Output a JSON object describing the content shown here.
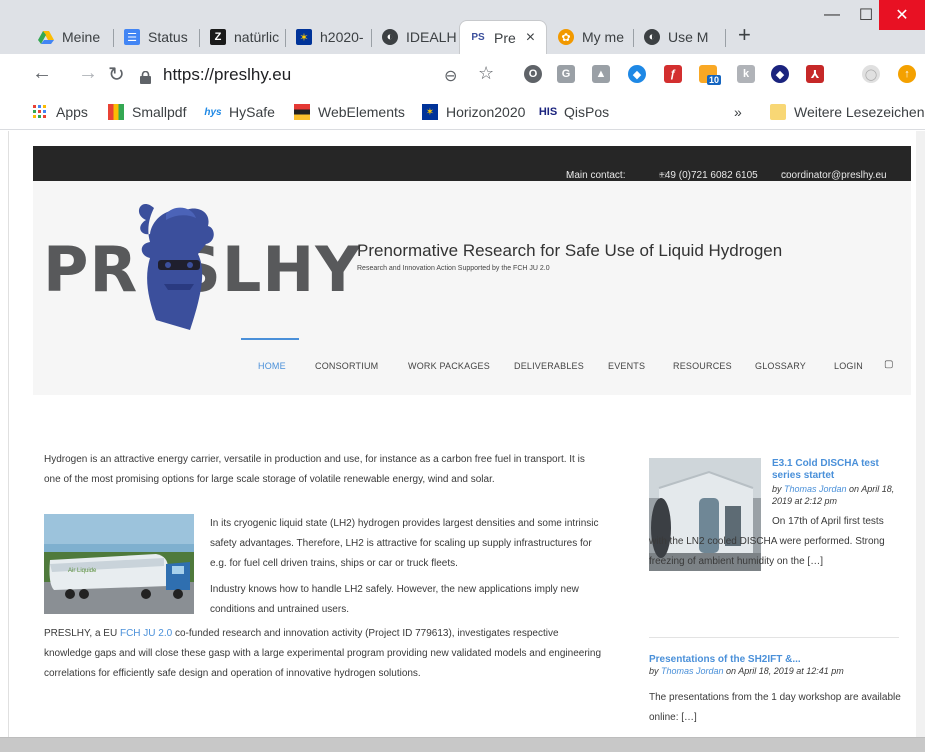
{
  "browser": {
    "tabs": [
      {
        "label": "Meine",
        "icon": "google-drive-icon"
      },
      {
        "label": "Status",
        "icon": "list-doc-icon"
      },
      {
        "label": "natürlic",
        "icon": "z-logo-icon"
      },
      {
        "label": "h2020-",
        "icon": "eu-flag-icon"
      },
      {
        "label": "IDEALH",
        "icon": "globe-icon"
      },
      {
        "label": "Pre",
        "icon": "preslhy-favicon-icon",
        "active": true,
        "close": "×"
      },
      {
        "label": "My me",
        "icon": "orange-flower-icon"
      },
      {
        "label": "Use M",
        "icon": "globe-icon"
      }
    ],
    "new_tab": "+",
    "window_controls": {
      "minimize": "—",
      "maximize": "☐",
      "close": "✕"
    },
    "url": "https://preslhy.eu",
    "extension_badge": "10",
    "bookmarks": [
      {
        "label": "Apps",
        "icon": "apps-grid-icon"
      },
      {
        "label": "Smallpdf",
        "icon": "smallpdf-icon"
      },
      {
        "label": "HySafe",
        "icon": "hysafe-icon"
      },
      {
        "label": "WebElements",
        "icon": "webelements-icon"
      },
      {
        "label": "Horizon2020",
        "icon": "eu-flag-icon"
      },
      {
        "label": "QisPos",
        "icon": "his-icon"
      }
    ],
    "bookmarks_overflow": "»",
    "other_bookmarks": "Weitere Lesezeichen"
  },
  "site": {
    "topbar": {
      "contact_label": "Main contact:",
      "phone": "+49 (0)721 6082 6105",
      "email": "coordinator@preslhy.eu"
    },
    "logo_text_left": "PR",
    "logo_text_right": "SLHY",
    "tagline": "Prenormative Research for Safe Use of Liquid Hydrogen",
    "subtagline": "Research and Innovation Action Supported by the FCH JU 2.0",
    "menu": [
      {
        "label": "HOME",
        "active": true
      },
      {
        "label": "CONSORTIUM"
      },
      {
        "label": "WORK PACKAGES"
      },
      {
        "label": "DELIVERABLES"
      },
      {
        "label": "EVENTS"
      },
      {
        "label": "RESOURCES"
      },
      {
        "label": "GLOSSARY"
      },
      {
        "label": "LOGIN"
      }
    ],
    "intro": {
      "p1": "Hydrogen is an attractive energy carrier, versatile in production and use, for instance as a carbon free fuel in transport. It is one of the most promising options for large scale storage of volatile renewable energy, wind and solar.",
      "p2": "In its cryogenic liquid state (LH2)  hydrogen provides largest densities and some intrinsic safety advantages. Therefore,  LH2 is attractive for scaling up supply infrastructures for e.g. for fuel cell driven trains, ships or car or truck fleets.",
      "p3": "Industry knows how to handle LH2 safely. However, the new applications imply new conditions and untrained users.",
      "p4_before": "PRESLHY, a EU ",
      "p4_link": "FCH JU 2.0",
      "p4_after": " co-funded research and innovation activity (Project ID 779613), investigates respective knowledge gaps and will close these gasp with a large experimental program providing new validated models and engineering correlations for efficiently safe design and operation of innovative hydrogen solutions."
    },
    "posts": [
      {
        "title": "E3.1 Cold DISCHA test series startet",
        "by": "by ",
        "author": "Thomas Jordan",
        "date": " on April 18, 2019 at 2:12 pm",
        "body": "On 17th of April first tests with the LN2 cooled DISCHA were performed. Strong freezing of ambient humidity on the […]"
      },
      {
        "title": "Presentations of the SH2IFT &...",
        "by": "by ",
        "author": "Thomas Jordan",
        "date": " on April 18, 2019 at 12:41 pm",
        "body": "The presentations from the 1 day workshop are available online: […]"
      }
    ]
  },
  "colors": {
    "accent": "#4a90d9",
    "topbar_bg": "#262626",
    "header_bg": "#f6f6f6",
    "logo_gray": "#58595b",
    "mascot_blue": "#3b4f9c"
  }
}
